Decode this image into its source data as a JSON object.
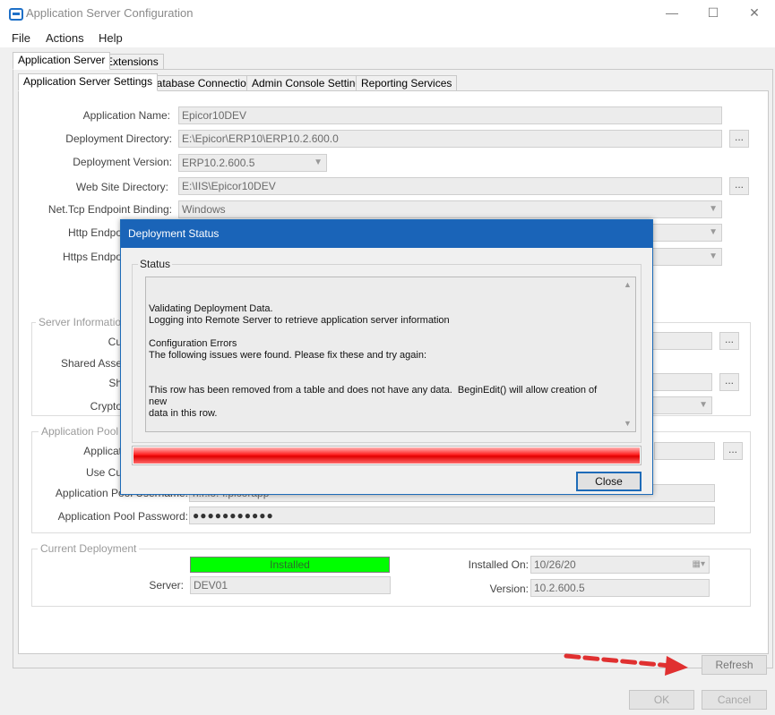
{
  "window": {
    "title": "Application Server Configuration",
    "minimize": "—",
    "maximize": "☐",
    "close": "✕"
  },
  "menu": {
    "file": "File",
    "actions": "Actions",
    "help": "Help"
  },
  "top_tabs": {
    "app_server": "Application Server",
    "extensions": "Extensions"
  },
  "sub_tabs": {
    "settings": "Application Server Settings",
    "database": "Database Connection",
    "admin_console": "Admin Console Settings",
    "reporting": "Reporting Services"
  },
  "form": {
    "app_name_label": "Application Name:",
    "app_name_value": "Epicor10DEV",
    "deploy_dir_label": "Deployment Directory:",
    "deploy_dir_value": "E:\\Epicor\\ERP10\\ERP10.2.600.0",
    "deploy_ver_label": "Deployment Version:",
    "deploy_ver_value": "ERP10.2.600.5",
    "website_dir_label": "Web Site Directory:",
    "website_dir_value": "E:\\IIS\\Epicor10DEV",
    "nettcp_label": "Net.Tcp Endpoint Binding:",
    "nettcp_value": "Windows",
    "http_label": "Http Endpo",
    "https_label": "Https Endpo",
    "browse": "..."
  },
  "server_info": {
    "title": "Server Information",
    "cu_label": "Cu",
    "shared_label": "Shared Asse",
    "sh_label": "Sh",
    "crypto_label": "Crypto"
  },
  "app_pool": {
    "title": "Application Pool",
    "applic_label": "Applicat",
    "use_label": "Use Cu",
    "username_label": "Application Pool Username:",
    "username_value": "h.r.lo.-l.picorapp",
    "password_label": "Application Pool Password:",
    "password_value": "●●●●●●●●●●●"
  },
  "current_deployment": {
    "title": "Current Deployment",
    "status": "Installed",
    "server_label": "Server:",
    "server_value": "DEV01",
    "installed_on_label": "Installed On:",
    "installed_on_value": "10/26/20",
    "version_label": "Version:",
    "version_value": "10.2.600.5"
  },
  "buttons": {
    "refresh": "Refresh",
    "ok": "OK",
    "cancel": "Cancel"
  },
  "dialog": {
    "title": "Deployment Status",
    "status_label": "Status",
    "status_text": "Validating Deployment Data.\nLogging into Remote Server to retrieve application server information\n\nConfiguration Errors\nThe following issues were found. Please fix these and try again:\n\n\nThis row has been removed from a table and does not have any data.  BeginEdit() will allow creation of new\ndata in this row.",
    "close": "Close"
  },
  "colors": {
    "accent": "#1a64b8",
    "installed_green": "#00ff00",
    "progress_red": "#ff2020",
    "arrow_red": "#e03030"
  },
  "icons": {
    "app": "server-config-icon",
    "calendar": "calendar-icon",
    "arrow": "dashed-arrow-annotation"
  }
}
